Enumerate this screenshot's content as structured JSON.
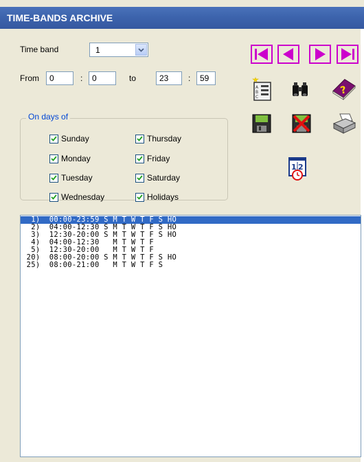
{
  "window": {
    "title": "TIME-BANDS ARCHIVE"
  },
  "form": {
    "time_band_label": "Time band",
    "time_band_value": "1",
    "from_label": "From",
    "from_hour": "0",
    "from_minute": "0",
    "to_label": "to",
    "to_hour": "23",
    "to_minute": "59",
    "colon": ":"
  },
  "days": {
    "legend": "On days of",
    "items": [
      {
        "label": "Sunday",
        "checked": true
      },
      {
        "label": "Monday",
        "checked": true
      },
      {
        "label": "Tuesday",
        "checked": true
      },
      {
        "label": "Wednesday",
        "checked": true
      },
      {
        "label": "Thursday",
        "checked": true
      },
      {
        "label": "Friday",
        "checked": true
      },
      {
        "label": "Saturday",
        "checked": true
      },
      {
        "label": "Holidays",
        "checked": true
      }
    ]
  },
  "toolbar": {
    "icons": [
      "first-record-icon",
      "previous-record-icon",
      "next-record-icon",
      "last-record-icon",
      "new-record-icon",
      "find-icon",
      "help-book-icon",
      "save-icon",
      "delete-icon",
      "print-icon",
      "calendar-clock-icon"
    ],
    "accent": "#cc00cc"
  },
  "list": {
    "selected_index": 0,
    "rows": [
      "  1)  00:00-23:59 S M T W T F S HO",
      "  2)  04:00-12:30 S M T W T F S HO",
      "  3)  12:30-20:00 S M T W T F S HO",
      "  4)  04:00-12:30   M T W T F",
      "  5)  12:30-20:00   M T W T F",
      " 20)  08:00-20:00 S M T W T F S HO",
      " 25)  08:00-21:00   M T W T F S"
    ]
  }
}
